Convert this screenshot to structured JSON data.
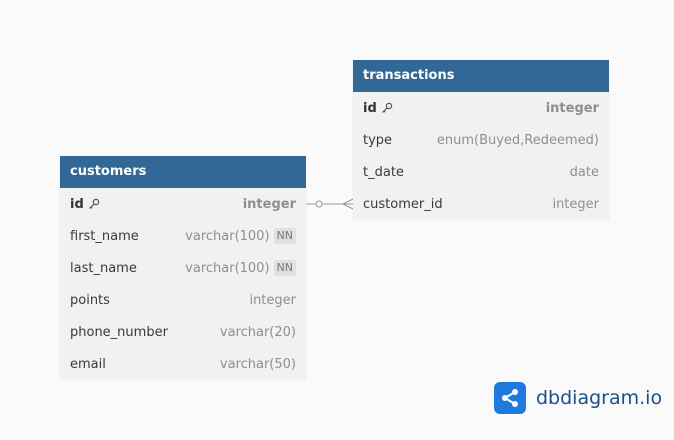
{
  "tables": [
    {
      "name": "customers",
      "columns": [
        {
          "name": "id",
          "type": "integer",
          "pk": true
        },
        {
          "name": "first_name",
          "type": "varchar(100)",
          "badge": "NN"
        },
        {
          "name": "last_name",
          "type": "varchar(100)",
          "badge": "NN"
        },
        {
          "name": "points",
          "type": "integer"
        },
        {
          "name": "phone_number",
          "type": "varchar(20)"
        },
        {
          "name": "email",
          "type": "varchar(50)"
        }
      ]
    },
    {
      "name": "transactions",
      "columns": [
        {
          "name": "id",
          "type": "integer",
          "pk": true
        },
        {
          "name": "type",
          "type": "enum(Buyed,Redeemed)"
        },
        {
          "name": "t_date",
          "type": "date"
        },
        {
          "name": "customer_id",
          "type": "integer"
        }
      ]
    }
  ],
  "relationship": {
    "from": "customers.id",
    "to": "transactions.customer_id",
    "type": "one-to-many"
  },
  "brand": {
    "text": "dbdiagram.io",
    "icon": "share-nodes-icon"
  },
  "colors": {
    "header": "#316896",
    "brand_blue": "#1f7ae0",
    "brand_text": "#1c4f86"
  }
}
